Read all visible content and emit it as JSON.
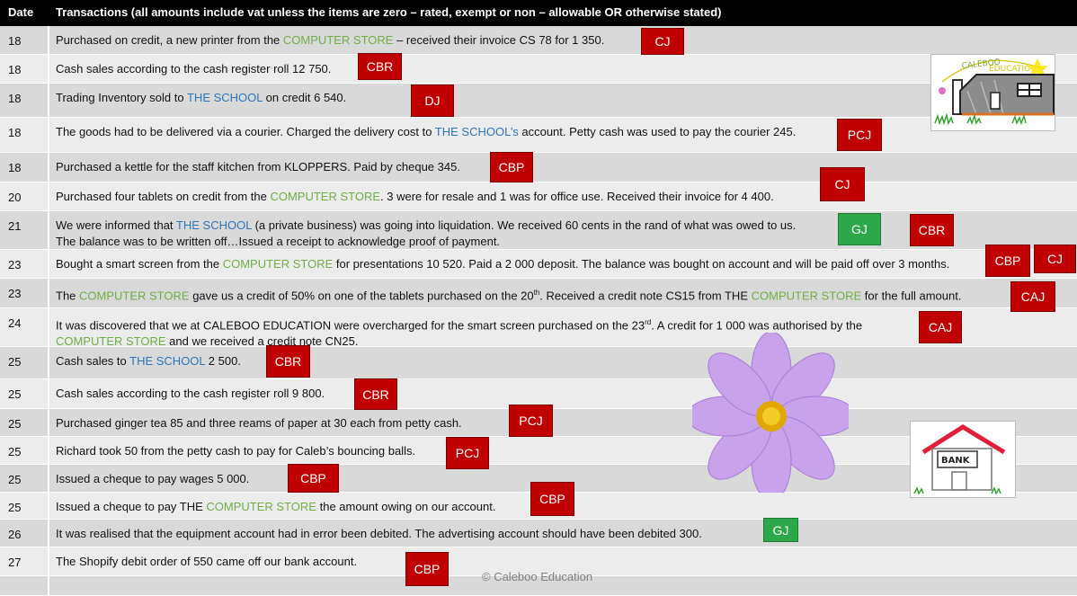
{
  "header": {
    "date_label": "Date",
    "transactions_label": "Transactions (all amounts include vat unless the items are zero – rated, exempt or non – allowable OR otherwise stated)"
  },
  "rows": [
    {
      "date": "18",
      "parts": [
        "Purchased on credit, a new printer from the ",
        "COMPUTER STORE",
        " – received their invoice CS 78  for 1 350."
      ]
    },
    {
      "date": "18",
      "parts": [
        "Cash sales according to the cash register roll 12 750."
      ]
    },
    {
      "date": "18",
      "parts": [
        "Trading Inventory sold to ",
        "THE SCHOOL",
        " on credit 6 540."
      ]
    },
    {
      "date": "18",
      "parts": [
        "The goods had to be delivered via a courier. Charged the delivery cost to ",
        "THE SCHOOL’s",
        " account. Petty cash was used to pay the courier 245."
      ]
    },
    {
      "date": "18",
      "parts": [
        "Purchased a kettle for the staff kitchen from KLOPPERS. Paid by cheque 345."
      ]
    },
    {
      "date": "20",
      "parts": [
        "Purchased four tablets on credit from the ",
        "COMPUTER STORE",
        ". 3 were for resale and 1 was for office use. Received their invoice for 4 400."
      ]
    },
    {
      "date": "21",
      "parts": [
        "We were informed that ",
        "THE SCHOOL",
        " (a private business) was going into liquidation. We received 60 cents in the rand of what was owed to us."
      ],
      "line2": "The balance was to be written off…Issued a receipt to acknowledge proof of payment."
    },
    {
      "date": "23",
      "parts": [
        "Bought a smart screen from the ",
        "COMPUTER STORE",
        " for presentations 10 520. Paid a 2 000 deposit. The balance was bought on account and will be paid off over 3 months."
      ]
    },
    {
      "date": "23",
      "parts": [
        "The ",
        "COMPUTER STORE",
        " gave us a credit of 50% on one of the tablets purchased on the 20",
        "th",
        ". Received a credit note CS15  from THE ",
        "COMPUTER STORE",
        " for the full amount."
      ]
    },
    {
      "date": "24",
      "parts": [
        "It was discovered that we at CALEBOO EDUCATION were overcharged for the smart screen purchased on the 23",
        "rd",
        ". A credit for 1 000 was authorised by the"
      ],
      "line2_parts": [
        "COMPUTER STORE",
        " and we received a credit note CN25."
      ]
    },
    {
      "date": "25",
      "parts": [
        "Cash sales to ",
        "THE SCHOOL",
        " 2 500."
      ]
    },
    {
      "date": "25",
      "parts": [
        "Cash sales according to the cash register roll 9 800."
      ]
    },
    {
      "date": "25",
      "parts": [
        "Purchased ginger tea 85 and three reams of paper at 30 each from petty cash."
      ]
    },
    {
      "date": "25",
      "parts": [
        "Richard took 50 from the petty cash to pay for Caleb’s bouncing balls."
      ]
    },
    {
      "date": "25",
      "parts": [
        "Issued a cheque to pay wages 5 000."
      ]
    },
    {
      "date": "25",
      "parts": [
        "Issued a cheque to pay THE ",
        "COMPUTER STORE",
        " the amount owing on our account."
      ]
    },
    {
      "date": "26",
      "parts": [
        "It was realised that the equipment account had in error been debited. The advertising account should have been debited 300."
      ]
    },
    {
      "date": "27",
      "parts": [
        "The Shopify debit order of 550 came off our bank account."
      ]
    },
    {
      "date": "",
      "parts": [
        ""
      ]
    }
  ],
  "badges": [
    "CJ",
    "CBR",
    "DJ",
    "PCJ",
    "CBP",
    "CJ",
    "GJ",
    "CBR",
    "CBP",
    "CJ",
    "CAJ",
    "CAJ",
    "CBR",
    "CBR",
    "PCJ",
    "PCJ",
    "CBP",
    "CBP",
    "GJ",
    "CBP"
  ],
  "logo_text": "CALEBOO EDUCATION",
  "bank_sign": "BANK",
  "copyright": "© Caleboo Education",
  "colors": {
    "header_bg": "#000000",
    "journal_badge": "#c00000",
    "gj_badge": "#2ca84a",
    "computer_store": "#70ad47",
    "the_school": "#2e75b6"
  }
}
